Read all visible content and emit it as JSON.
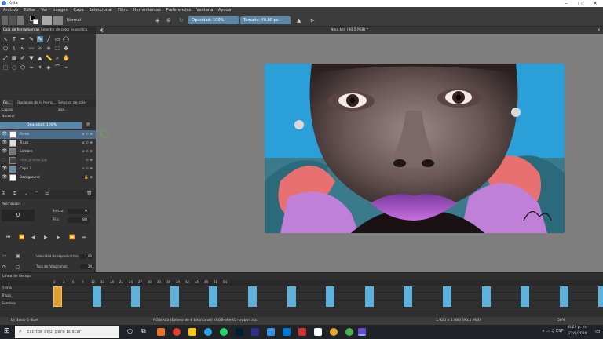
{
  "window": {
    "title": "Krita",
    "minimize": "–",
    "maximize": "□",
    "close": "✕"
  },
  "menu": [
    "Archivo",
    "Editar",
    "Ver",
    "Imagen",
    "Capa",
    "Seleccionar",
    "Filtro",
    "Herramientas",
    "Preferencias",
    "Ventana",
    "Ayuda"
  ],
  "toolbar": {
    "blend_mode": "Normal",
    "opacity": "Opacidad: 100%",
    "size": "Tamaño: 40,00 px",
    "colors": {
      "accent": "#5a86a8",
      "fg": "#000000",
      "bg": "#ffffff"
    }
  },
  "left_tabs": [
    "Caja de herramientas",
    "Selector de color específico"
  ],
  "tools": [
    "pointer-icon",
    "text-icon",
    "calligraphy-icon",
    "pen-icon",
    "brush-icon",
    "line-icon",
    "rect-icon",
    "ellipse-icon",
    "polygon-icon",
    "polyline-icon",
    "bezier-icon",
    "freehand-path-icon",
    "dynamic-brush-icon",
    "multibrush-icon",
    "crop-icon",
    "move-icon",
    "transform-icon",
    "gradient-icon",
    "colorpicker-icon",
    "fill-icon",
    "assistant-icon",
    "measure-icon",
    "zoom-icon",
    "pan-icon",
    "select-rect-icon",
    "select-ellipse-icon",
    "select-poly-icon",
    "select-free-icon",
    "select-contig-icon",
    "select-similar-icon",
    "select-bezier-icon",
    "select-magnetic-icon"
  ],
  "mid_tabs": [
    "Co...",
    "Opciones de la herra...",
    "Selector de color ava..."
  ],
  "layers": {
    "title": "Capas",
    "blend": "Normal",
    "opacity": "Opacidad: 100%",
    "items": [
      {
        "name": "Firma",
        "selected": true
      },
      {
        "name": "Trazo",
        "selected": false
      },
      {
        "name": "Sombra",
        "selected": false
      },
      {
        "name": "nina_ghosso.jpg",
        "selected": false
      },
      {
        "name": "Capa 2",
        "selected": false
      },
      {
        "name": "Background",
        "selected": false
      }
    ]
  },
  "animation": {
    "title": "Animación",
    "frame": "0",
    "start_label": "Inicio:",
    "start": "0",
    "end_label": "Fin:",
    "end": "88",
    "speed_label": "Velocidad de reproducción:",
    "speed": "1,00",
    "fps_label": "Tasa de fotogramas:",
    "fps": "24"
  },
  "canvas": {
    "doc_title": "Nina.kra (90,5 MiB) *"
  },
  "timeline": {
    "title": "Línea de tiempo",
    "rows": [
      "Firma",
      "Trazo",
      "Sombra"
    ],
    "ticks": [
      "0",
      "3",
      "6",
      "9",
      "12",
      "15",
      "18",
      "21",
      "24",
      "27",
      "30",
      "33",
      "36",
      "39",
      "42",
      "45",
      "48",
      "51",
      "54"
    ],
    "keyframes": [
      0,
      4,
      8,
      12,
      16,
      20,
      24,
      28,
      32,
      36,
      40,
      44,
      48,
      52,
      56
    ]
  },
  "status": {
    "brush": "b) Basic-5 Size",
    "color": "RGB/Alfa (Entero de 8 bits/canal) sRGB-elle-V2-srgbtrc.icc",
    "dims": "1.920 x 1.080 (90,5 MiB)",
    "zoom": "50%"
  },
  "taskbar": {
    "search_placeholder": "Escribe aquí para buscar",
    "time": "6:27 p. m.",
    "date": "22/9/2020",
    "lang": "ESP"
  }
}
